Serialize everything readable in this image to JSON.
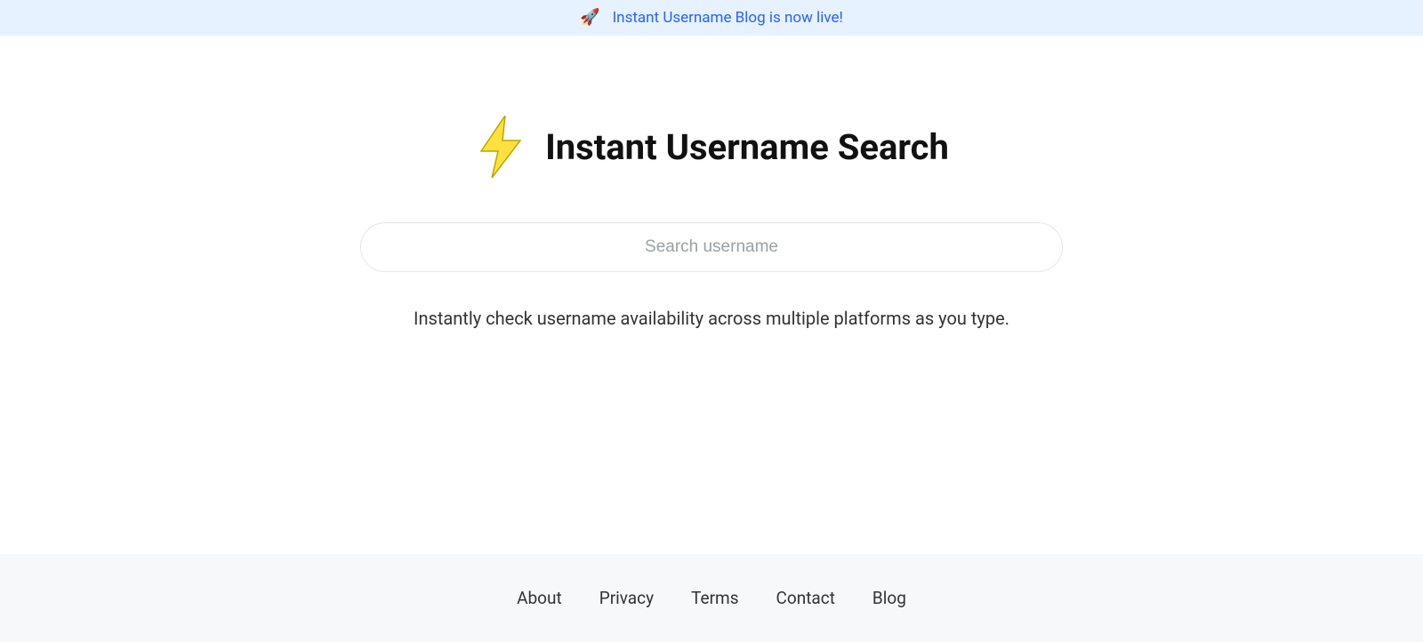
{
  "banner": {
    "icon_name": "rocket-icon",
    "text": "Instant Username Blog is now live!"
  },
  "hero": {
    "icon_name": "lightning-bolt-icon",
    "title": "Instant Username Search",
    "search_placeholder": "Search username",
    "tagline": "Instantly check username availability across multiple platforms as you type."
  },
  "footer": {
    "links": [
      {
        "label": "About"
      },
      {
        "label": "Privacy"
      },
      {
        "label": "Terms"
      },
      {
        "label": "Contact"
      },
      {
        "label": "Blog"
      }
    ]
  }
}
